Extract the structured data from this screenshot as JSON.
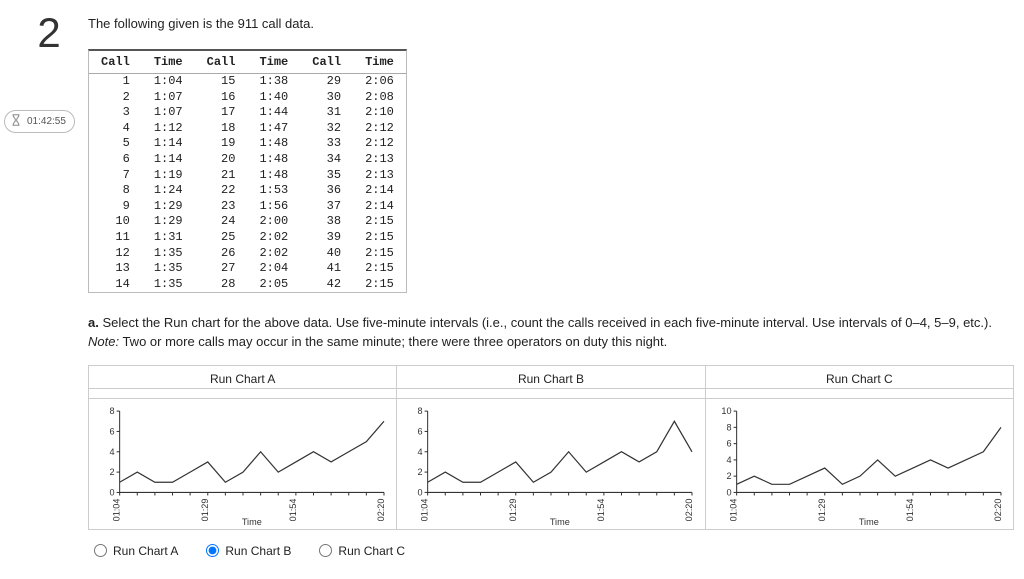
{
  "question_number": "2",
  "timer": "01:42:55",
  "intro_text": "The following given is the 911 call data.",
  "table": {
    "headers": [
      "Call",
      "Time",
      "Call",
      "Time",
      "Call",
      "Time"
    ],
    "rows": [
      [
        "1",
        "1:04",
        "15",
        "1:38",
        "29",
        "2:06"
      ],
      [
        "2",
        "1:07",
        "16",
        "1:40",
        "30",
        "2:08"
      ],
      [
        "3",
        "1:07",
        "17",
        "1:44",
        "31",
        "2:10"
      ],
      [
        "4",
        "1:12",
        "18",
        "1:47",
        "32",
        "2:12"
      ],
      [
        "5",
        "1:14",
        "19",
        "1:48",
        "33",
        "2:12"
      ],
      [
        "6",
        "1:14",
        "20",
        "1:48",
        "34",
        "2:13"
      ],
      [
        "7",
        "1:19",
        "21",
        "1:48",
        "35",
        "2:13"
      ],
      [
        "8",
        "1:24",
        "22",
        "1:53",
        "36",
        "2:14"
      ],
      [
        "9",
        "1:29",
        "23",
        "1:56",
        "37",
        "2:14"
      ],
      [
        "10",
        "1:29",
        "24",
        "2:00",
        "38",
        "2:15"
      ],
      [
        "11",
        "1:31",
        "25",
        "2:02",
        "39",
        "2:15"
      ],
      [
        "12",
        "1:35",
        "26",
        "2:02",
        "40",
        "2:15"
      ],
      [
        "13",
        "1:35",
        "27",
        "2:04",
        "41",
        "2:15"
      ],
      [
        "14",
        "1:35",
        "28",
        "2:05",
        "42",
        "2:15"
      ]
    ]
  },
  "question_a_prefix": "a. ",
  "question_a_body": "Select the Run chart for the above data. Use five-minute intervals (i.e., count the calls received in each five-minute interval. Use intervals of 0–4, 5–9, etc.). ",
  "question_a_note_label": "Note:",
  "question_a_note": " Two or more calls may occur in the same minute; there were three operators on duty this night.",
  "chart_titles": [
    "Run Chart A",
    "Run Chart B",
    "Run Chart C"
  ],
  "chart_x_label": "Time",
  "chart_x_ticks": [
    "01:04",
    "01:29",
    "01:54",
    "02:20"
  ],
  "options": [
    "Run Chart A",
    "Run Chart B",
    "Run Chart C"
  ],
  "chart_data": [
    {
      "type": "line",
      "title": "Run Chart A",
      "xlabel": "Time",
      "ylabel": "",
      "ylim": [
        0,
        8
      ],
      "y_ticks": [
        0,
        2,
        4,
        6,
        8
      ],
      "x_ticks": [
        "01:04",
        "01:29",
        "01:54",
        "02:20"
      ],
      "x": [
        0,
        1,
        2,
        3,
        4,
        5,
        6,
        7,
        8,
        9,
        10,
        11,
        12,
        13,
        14,
        15
      ],
      "values": [
        1,
        2,
        1,
        1,
        2,
        3,
        1,
        2,
        4,
        2,
        3,
        4,
        3,
        4,
        5,
        7
      ]
    },
    {
      "type": "line",
      "title": "Run Chart B",
      "xlabel": "Time",
      "ylabel": "",
      "ylim": [
        0,
        8
      ],
      "y_ticks": [
        0,
        2,
        4,
        6,
        8
      ],
      "x_ticks": [
        "01:04",
        "01:29",
        "01:54",
        "02:20"
      ],
      "x": [
        0,
        1,
        2,
        3,
        4,
        5,
        6,
        7,
        8,
        9,
        10,
        11,
        12,
        13,
        14,
        15
      ],
      "values": [
        1,
        2,
        1,
        1,
        2,
        3,
        1,
        2,
        4,
        2,
        3,
        4,
        3,
        4,
        7,
        4
      ]
    },
    {
      "type": "line",
      "title": "Run Chart C",
      "xlabel": "Time",
      "ylabel": "",
      "ylim": [
        0,
        10
      ],
      "y_ticks": [
        0,
        2,
        4,
        6,
        8,
        10
      ],
      "x_ticks": [
        "01:04",
        "01:29",
        "01:54",
        "02:20"
      ],
      "x": [
        0,
        1,
        2,
        3,
        4,
        5,
        6,
        7,
        8,
        9,
        10,
        11,
        12,
        13,
        14,
        15
      ],
      "values": [
        1,
        2,
        1,
        1,
        2,
        3,
        1,
        2,
        4,
        2,
        3,
        4,
        3,
        4,
        5,
        8
      ]
    }
  ]
}
